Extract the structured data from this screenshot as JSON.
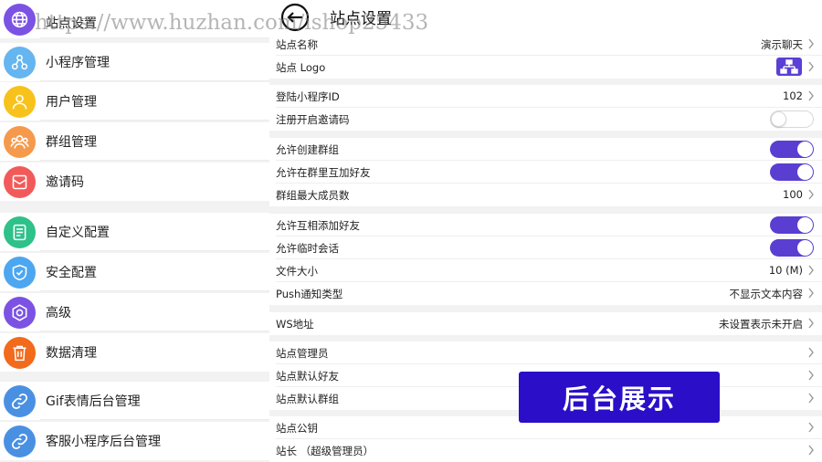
{
  "watermark": "https://www.huzhan.com/ishop25433",
  "sidebar": {
    "items": [
      {
        "label": "站点设置",
        "icon": "globe-icon",
        "color": "#7b52e3"
      },
      {
        "label": "小程序管理",
        "icon": "share-icon",
        "color": "#64b5f0"
      },
      {
        "label": "用户管理",
        "icon": "user-icon",
        "color": "#f7c21c"
      },
      {
        "label": "群组管理",
        "icon": "group-icon",
        "color": "#f59a4c"
      },
      {
        "label": "邀请码",
        "icon": "mail-icon",
        "color": "#f25a5a"
      },
      {
        "label": "自定义配置",
        "icon": "document-icon",
        "color": "#2ec18a"
      },
      {
        "label": "安全配置",
        "icon": "shield-icon",
        "color": "#4da6f0"
      },
      {
        "label": "高级",
        "icon": "gear-icon",
        "color": "#7b52e3"
      },
      {
        "label": "数据清理",
        "icon": "trash-icon",
        "color": "#f26a1b"
      },
      {
        "label": "Gif表情后台管理",
        "icon": "link-icon",
        "color": "#4a90e2"
      },
      {
        "label": "客服小程序后台管理",
        "icon": "link-icon",
        "color": "#4a90e2"
      }
    ]
  },
  "panel": {
    "title": "站点设置",
    "back_icon": "back-arrow-icon",
    "rows": [
      {
        "label": "站点名称",
        "value": "演示聊天",
        "kind": "link"
      },
      {
        "label": "站点 Logo",
        "value": "",
        "kind": "logo"
      },
      {
        "label": "登陆小程序ID",
        "value": "102",
        "kind": "link"
      },
      {
        "label": "注册开启邀请码",
        "value": "",
        "kind": "toggle",
        "on": false
      },
      {
        "label": "允许创建群组",
        "value": "",
        "kind": "toggle",
        "on": true
      },
      {
        "label": "允许在群里互加好友",
        "value": "",
        "kind": "toggle",
        "on": true
      },
      {
        "label": "群组最大成员数",
        "value": "100",
        "kind": "link"
      },
      {
        "label": "允许互相添加好友",
        "value": "",
        "kind": "toggle",
        "on": true
      },
      {
        "label": "允许临时会话",
        "value": "",
        "kind": "toggle",
        "on": true
      },
      {
        "label": "文件大小",
        "value": "10 (M)",
        "kind": "link"
      },
      {
        "label": "Push通知类型",
        "value": "不显示文本内容",
        "kind": "link"
      },
      {
        "label": "WS地址",
        "value": "未设置表示未开启",
        "kind": "link"
      },
      {
        "label": "站点管理员",
        "value": "",
        "kind": "link"
      },
      {
        "label": "站点默认好友",
        "value": "",
        "kind": "link"
      },
      {
        "label": "站点默认群组",
        "value": "",
        "kind": "link"
      },
      {
        "label": "站点公钥",
        "value": "",
        "kind": "link"
      },
      {
        "label": "站长 （超级管理员）",
        "value": "",
        "kind": "link"
      }
    ]
  },
  "badge": {
    "text": "后台展示"
  },
  "colors": {
    "accent": "#5a3ed1",
    "badge": "#2a0ec8"
  }
}
